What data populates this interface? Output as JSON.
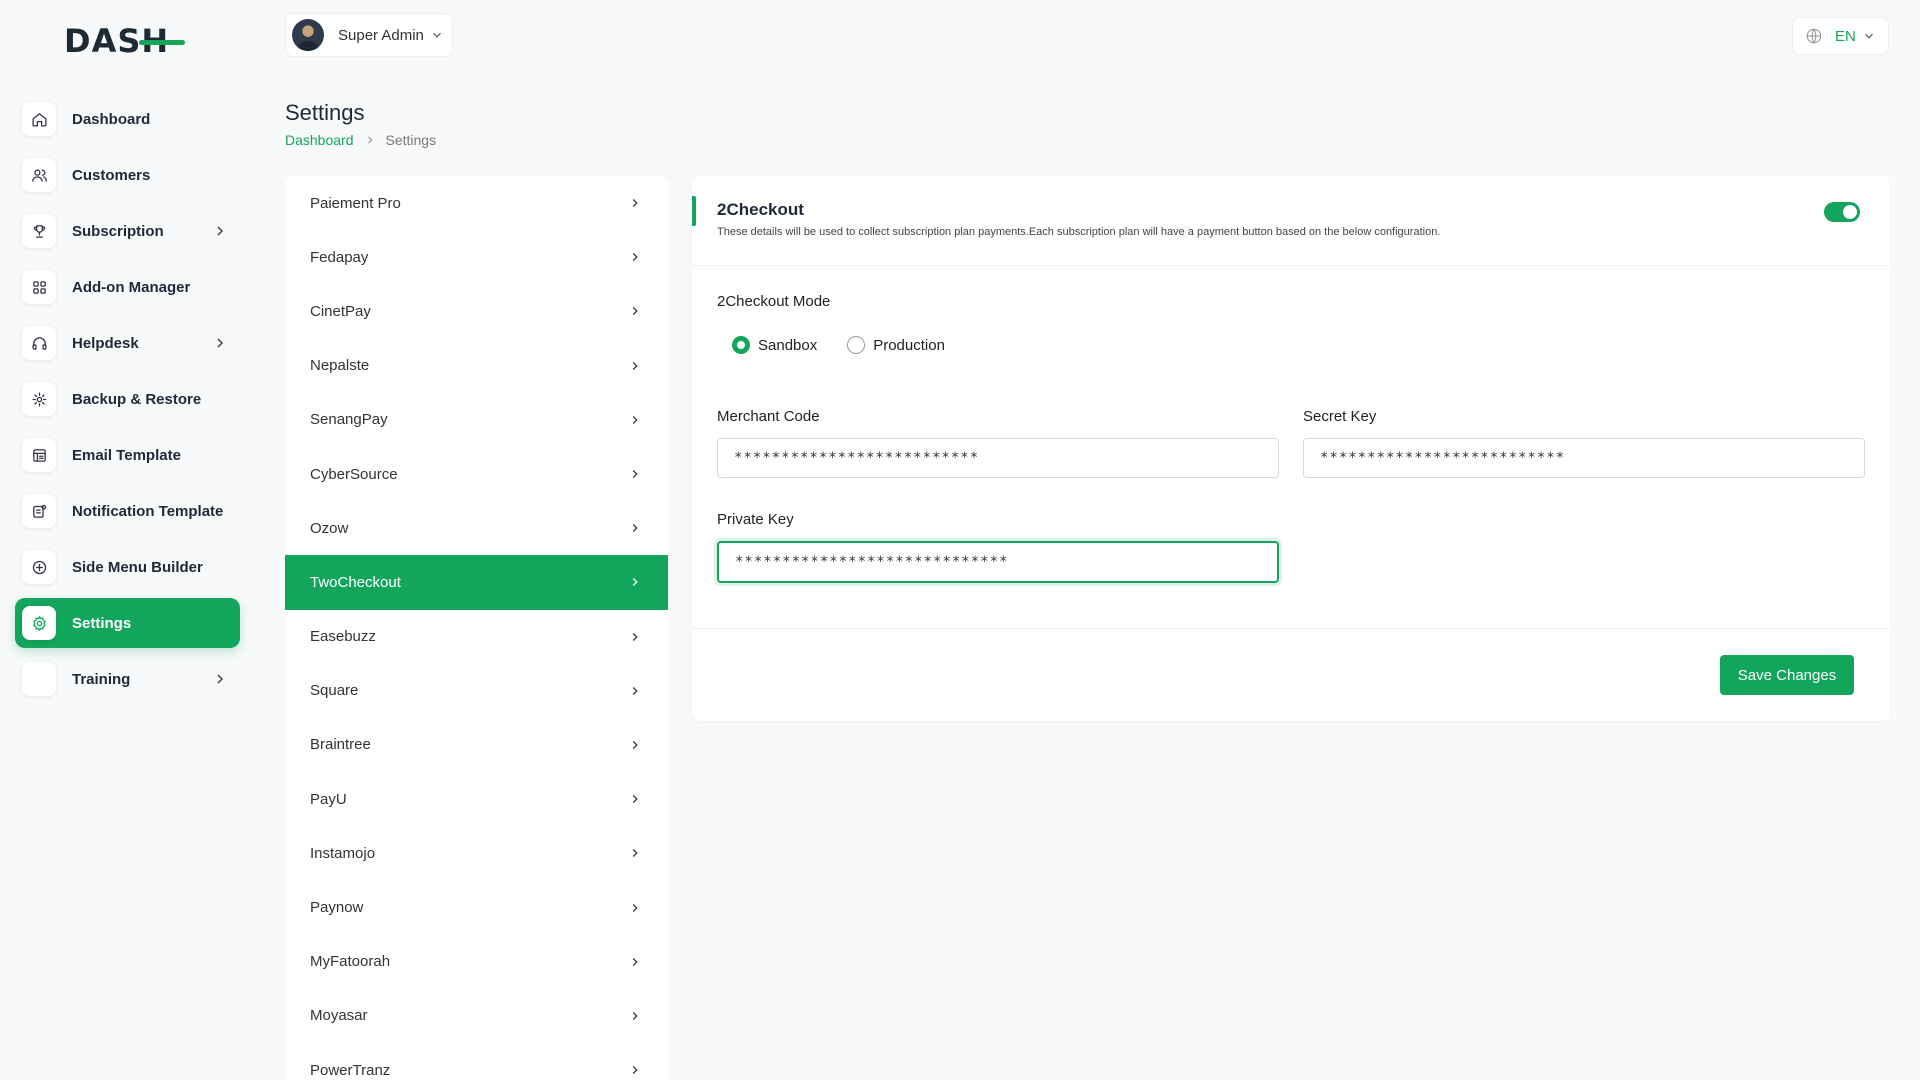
{
  "logo": {
    "text": "DASH"
  },
  "user": {
    "name": "Super Admin"
  },
  "language": {
    "code": "EN"
  },
  "page": {
    "title": "Settings"
  },
  "breadcrumb": {
    "home": "Dashboard",
    "current": "Settings"
  },
  "sidebar": {
    "items": [
      {
        "label": "Dashboard",
        "icon": "home-icon",
        "has_children": false,
        "active": false
      },
      {
        "label": "Customers",
        "icon": "users-icon",
        "has_children": false,
        "active": false
      },
      {
        "label": "Subscription",
        "icon": "trophy-icon",
        "has_children": true,
        "active": false
      },
      {
        "label": "Add-on Manager",
        "icon": "grid-icon",
        "has_children": false,
        "active": false
      },
      {
        "label": "Helpdesk",
        "icon": "headphones-icon",
        "has_children": true,
        "active": false
      },
      {
        "label": "Backup & Restore",
        "icon": "backup-icon",
        "has_children": false,
        "active": false
      },
      {
        "label": "Email Template",
        "icon": "template-icon",
        "has_children": false,
        "active": false
      },
      {
        "label": "Notification Template",
        "icon": "notification-icon",
        "has_children": false,
        "active": false
      },
      {
        "label": "Side Menu Builder",
        "icon": "plus-circle-icon",
        "has_children": false,
        "active": false
      },
      {
        "label": "Settings",
        "icon": "gear-icon",
        "has_children": false,
        "active": true
      },
      {
        "label": "Training",
        "icon": "training-icon",
        "has_children": true,
        "active": false
      }
    ]
  },
  "settings_menu": {
    "items": [
      {
        "label": "Paiement Pro",
        "active": false
      },
      {
        "label": "Fedapay",
        "active": false
      },
      {
        "label": "CinetPay",
        "active": false
      },
      {
        "label": "Nepalste",
        "active": false
      },
      {
        "label": "SenangPay",
        "active": false
      },
      {
        "label": "CyberSource",
        "active": false
      },
      {
        "label": "Ozow",
        "active": false
      },
      {
        "label": "TwoCheckout",
        "active": true
      },
      {
        "label": "Easebuzz",
        "active": false
      },
      {
        "label": "Square",
        "active": false
      },
      {
        "label": "Braintree",
        "active": false
      },
      {
        "label": "PayU",
        "active": false
      },
      {
        "label": "Instamojo",
        "active": false
      },
      {
        "label": "Paynow",
        "active": false
      },
      {
        "label": "MyFatoorah",
        "active": false
      },
      {
        "label": "Moyasar",
        "active": false
      },
      {
        "label": "PowerTranz",
        "active": false
      }
    ]
  },
  "card": {
    "title": "2Checkout",
    "description": "These details will be used to collect subscription plan payments.Each subscription plan will have a payment button based on the below configuration.",
    "enabled": true,
    "mode_label": "2Checkout Mode",
    "modes": [
      {
        "label": "Sandbox",
        "checked": true
      },
      {
        "label": "Production",
        "checked": false
      }
    ],
    "merchant_code": {
      "label": "Merchant Code",
      "value": "**************************"
    },
    "secret_key": {
      "label": "Secret Key",
      "value": "**************************"
    },
    "private_key": {
      "label": "Private Key",
      "value": "*****************************"
    },
    "save_label": "Save Changes"
  },
  "colors": {
    "accent": "#13a55b",
    "text": "#1f2937",
    "background": "#f8f9fa"
  }
}
